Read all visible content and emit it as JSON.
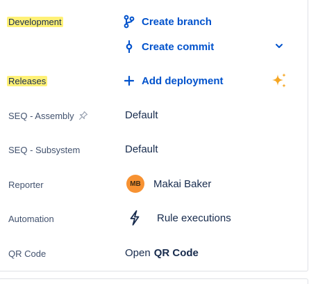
{
  "development": {
    "label": "Development",
    "create_branch": "Create branch",
    "create_commit": "Create commit"
  },
  "releases": {
    "label": "Releases",
    "add_deployment": "Add deployment"
  },
  "fields": {
    "seq_assembly": {
      "label": "SEQ - Assembly",
      "value": "Default"
    },
    "seq_subsystem": {
      "label": "SEQ - Subsystem",
      "value": "Default"
    },
    "reporter": {
      "label": "Reporter",
      "initials": "MB",
      "name": "Makai Baker"
    },
    "automation": {
      "label": "Automation",
      "value": "Rule executions"
    },
    "qr_code": {
      "label": "QR Code",
      "prefix": "Open",
      "link": "QR Code"
    }
  },
  "icons": {
    "branch": "git-branch-icon",
    "commit": "git-commit-icon",
    "add": "plus-icon",
    "expand": "chevron-down-icon",
    "ai": "sparkle-icon",
    "pin": "pin-icon",
    "automation": "lightning-bolt-icon"
  },
  "colors": {
    "link": "#0052cc",
    "highlight": "#fff176",
    "avatar": "#f79232",
    "sparkle": "#f5a623"
  }
}
